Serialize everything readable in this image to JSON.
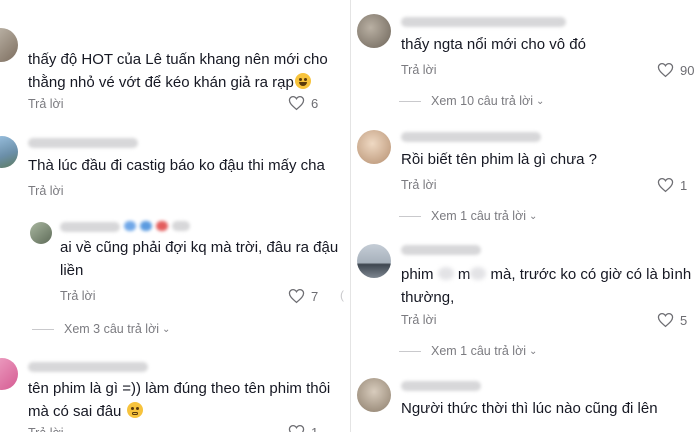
{
  "reply_label": "Trả lời",
  "left": {
    "comments": [
      {
        "lines": [
          "thấy độ HOT của Lê tuấn khang nên mới cho",
          "thằng nhỏ vé vớt để kéo khán giả ra rạp"
        ],
        "likes": "6"
      },
      {
        "lines": [
          "Thà lúc đầu đi castig báo ko đậu thi mấy cha"
        ]
      },
      {
        "lines": [
          "ai về cũng phải đợi kq mà trời, đâu ra đậu",
          "liền"
        ],
        "likes": "7"
      },
      {
        "view_replies": "Xem 3 câu trả lời"
      },
      {
        "lines": [
          "tên phim là gì =)) làm đúng theo tên phim thôi",
          "mà có sai đâu"
        ],
        "likes": "1"
      }
    ]
  },
  "right": {
    "comments": [
      {
        "lines": [
          "thấy ngta nổi mới cho vô đó"
        ],
        "likes": "90",
        "view_replies": "Xem 10 câu trả lời"
      },
      {
        "lines": [
          "Rồi biết tên phim là gì chưa ?"
        ],
        "likes": "1",
        "view_replies": "Xem 1 câu trả lời"
      },
      {
        "line1_a": "phim",
        "line1_b": "m",
        "line1_c": "mà, trước ko có giờ có là bình",
        "line2": "thường,",
        "likes": "5",
        "view_replies": "Xem 1 câu trả lời"
      },
      {
        "lines": [
          "Người thức thời thì lúc nào cũng đi lên"
        ]
      }
    ]
  },
  "icons": {
    "like": "heart-outline-icon",
    "expand": "chevron-down-icon"
  }
}
